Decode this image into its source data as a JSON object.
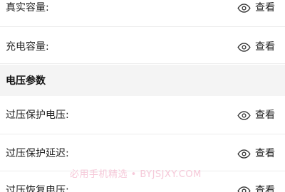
{
  "rows_top": [
    {
      "label": "真实容量:",
      "action": "查看"
    },
    {
      "label": "充电容量:",
      "action": "查看"
    }
  ],
  "section": {
    "title": "电压参数"
  },
  "rows_bottom": [
    {
      "label": "过压保护电压:",
      "action": "查看"
    },
    {
      "label": "过压保护延迟:",
      "action": "查看"
    },
    {
      "label": "过压恢复电压:",
      "action": "查看"
    }
  ],
  "watermark": "必用手机精选 • BYJSJXY.COM",
  "icons": {
    "view": "eye-icon"
  },
  "colors": {
    "section_background": "#f4f4f4",
    "divider": "#ececec",
    "watermark": "#f6c9d9",
    "text": "#222222"
  }
}
